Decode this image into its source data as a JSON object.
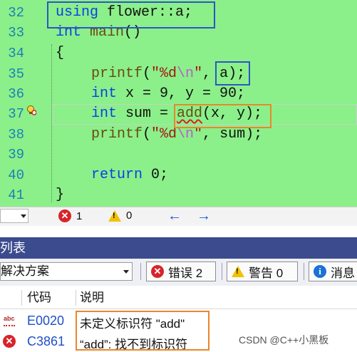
{
  "editor": {
    "line_numbers": [
      "32",
      "33",
      "34",
      "35",
      "36",
      "37",
      "38",
      "39",
      "40",
      "41"
    ],
    "lines": {
      "l32": {
        "kw": "using",
        "rest": " flower::a;"
      },
      "l33": {
        "kw": "int",
        "fn": "main",
        "rest": "()"
      },
      "l34": {
        "text": "{"
      },
      "l35": {
        "fn": "printf",
        "open": "(",
        "str1": "\"%d",
        "esc": "\\n",
        "str2": "\"",
        "rest": ", a);"
      },
      "l36": {
        "kw": "int",
        "rest": " x = 9, y = 90;"
      },
      "l37": {
        "kw": "int",
        "mid": " sum = ",
        "call": "add",
        "rest": "(x, y);"
      },
      "l38": {
        "fn": "printf",
        "open": "(",
        "str1": "\"%d",
        "esc": "\\n",
        "str2": "\"",
        "rest": ", sum);"
      },
      "l40": {
        "kw": "return",
        "rest": " 0;"
      },
      "l41": {
        "text": "}"
      }
    }
  },
  "status_strip": {
    "error_count": "1",
    "warning_count": "0"
  },
  "error_list": {
    "title": "列表",
    "scope": "解决方案",
    "filters": {
      "errors": "错误 2",
      "warnings": "警告 0",
      "messages": "消息"
    },
    "columns": {
      "code": "代码",
      "description": "说明"
    },
    "rows": [
      {
        "code": "E0020",
        "description": "未定义标识符 \"add\""
      },
      {
        "code": "C3861",
        "description": "“add”: 找不到标识符"
      }
    ]
  },
  "watermark": "CSDN @C++小黑板",
  "colors": {
    "editor_bg": "#8bf089",
    "keyword": "#0a40e8",
    "panel_title_bg": "#3b4b8e",
    "annotation_blue": "#2d55c8",
    "annotation_orange": "#e9872c"
  }
}
